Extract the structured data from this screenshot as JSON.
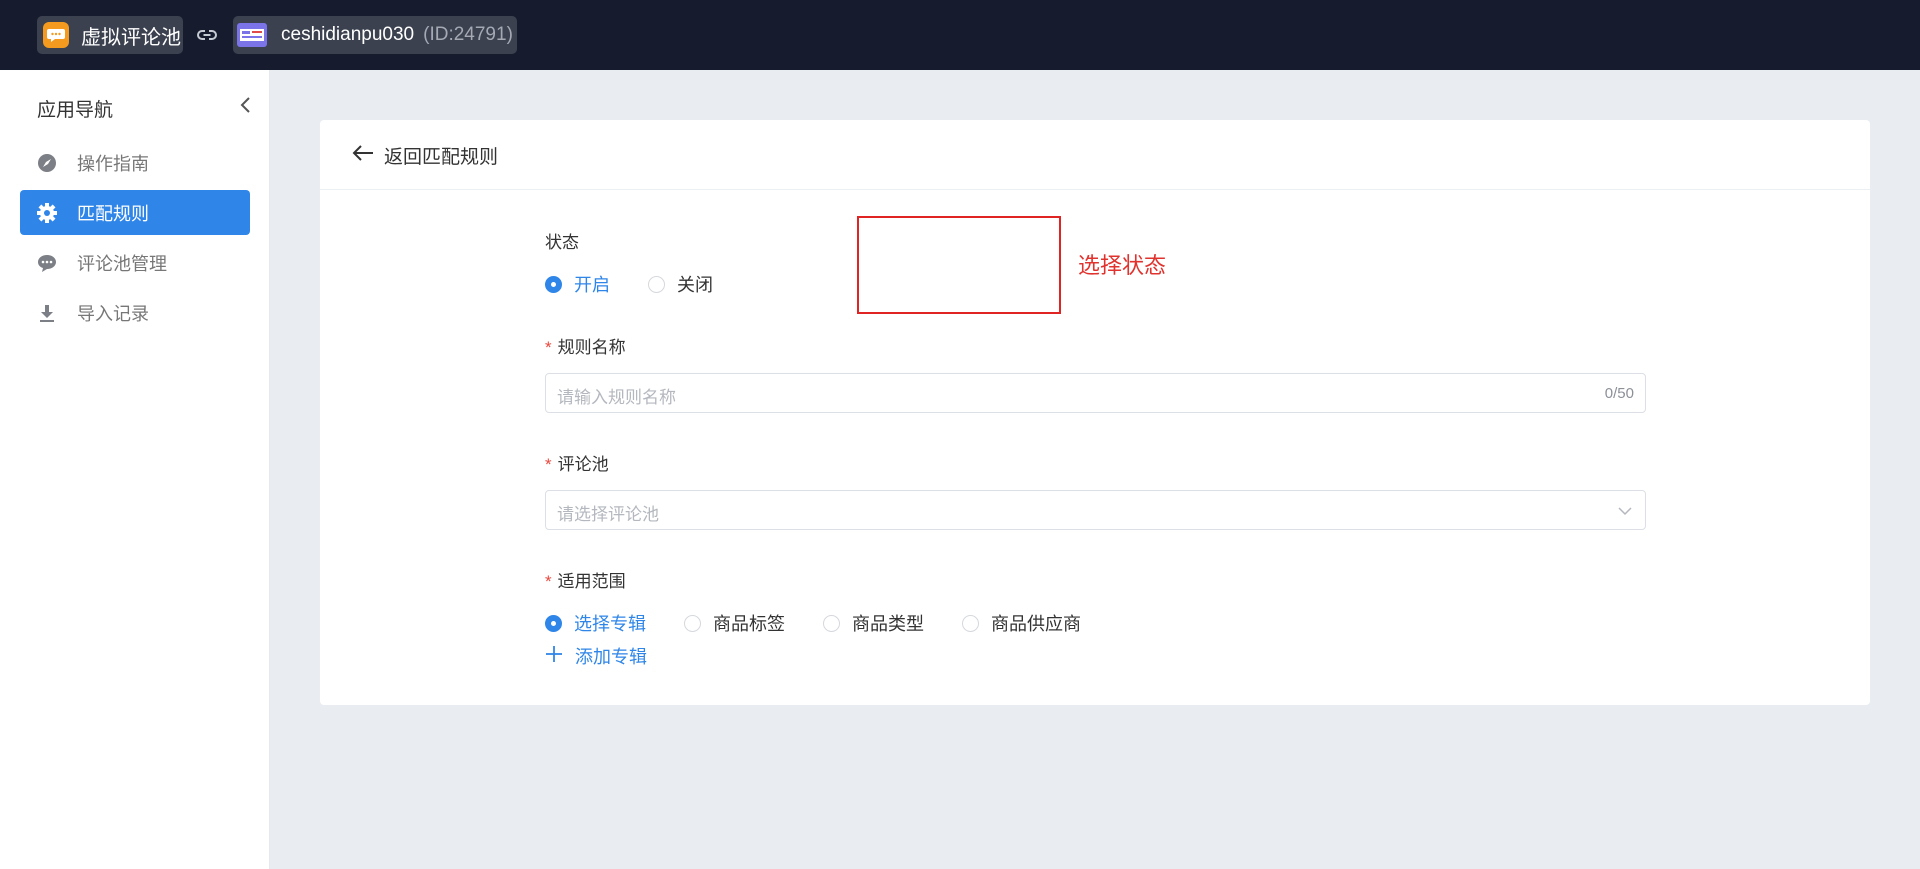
{
  "topbar": {
    "app_name": "虚拟评论池",
    "app_icon": "chat-bubble-icon",
    "link_icon": "link-icon",
    "shop_name": "ceshidianpu030",
    "shop_id": "(ID:24791)"
  },
  "sidebar": {
    "title": "应用导航",
    "items": [
      {
        "label": "操作指南",
        "icon": "compass-icon"
      },
      {
        "label": "匹配规则",
        "icon": "gear-icon",
        "active": true
      },
      {
        "label": "评论池管理",
        "icon": "comment-icon"
      },
      {
        "label": "导入记录",
        "icon": "download-icon"
      }
    ]
  },
  "page": {
    "back_label": "返回匹配规则"
  },
  "form": {
    "status": {
      "label": "状态",
      "options": [
        "开启",
        "关闭"
      ],
      "selected": "开启"
    },
    "annotation": "选择状态",
    "rule_name": {
      "label": "规则名称",
      "required_mark": "*",
      "placeholder": "请输入规则名称",
      "counter": "0/50"
    },
    "comment_pool": {
      "label": "评论池",
      "required_mark": "*",
      "placeholder": "请选择评论池"
    },
    "scope": {
      "label": "适用范围",
      "required_mark": "*",
      "options": [
        "选择专辑",
        "商品标签",
        "商品类型",
        "商品供应商"
      ],
      "selected": "选择专辑"
    },
    "add_album": "添加专辑"
  },
  "colors": {
    "topbar": "#161c2e",
    "accent": "#2f86e8",
    "annotation": "#e02323"
  }
}
